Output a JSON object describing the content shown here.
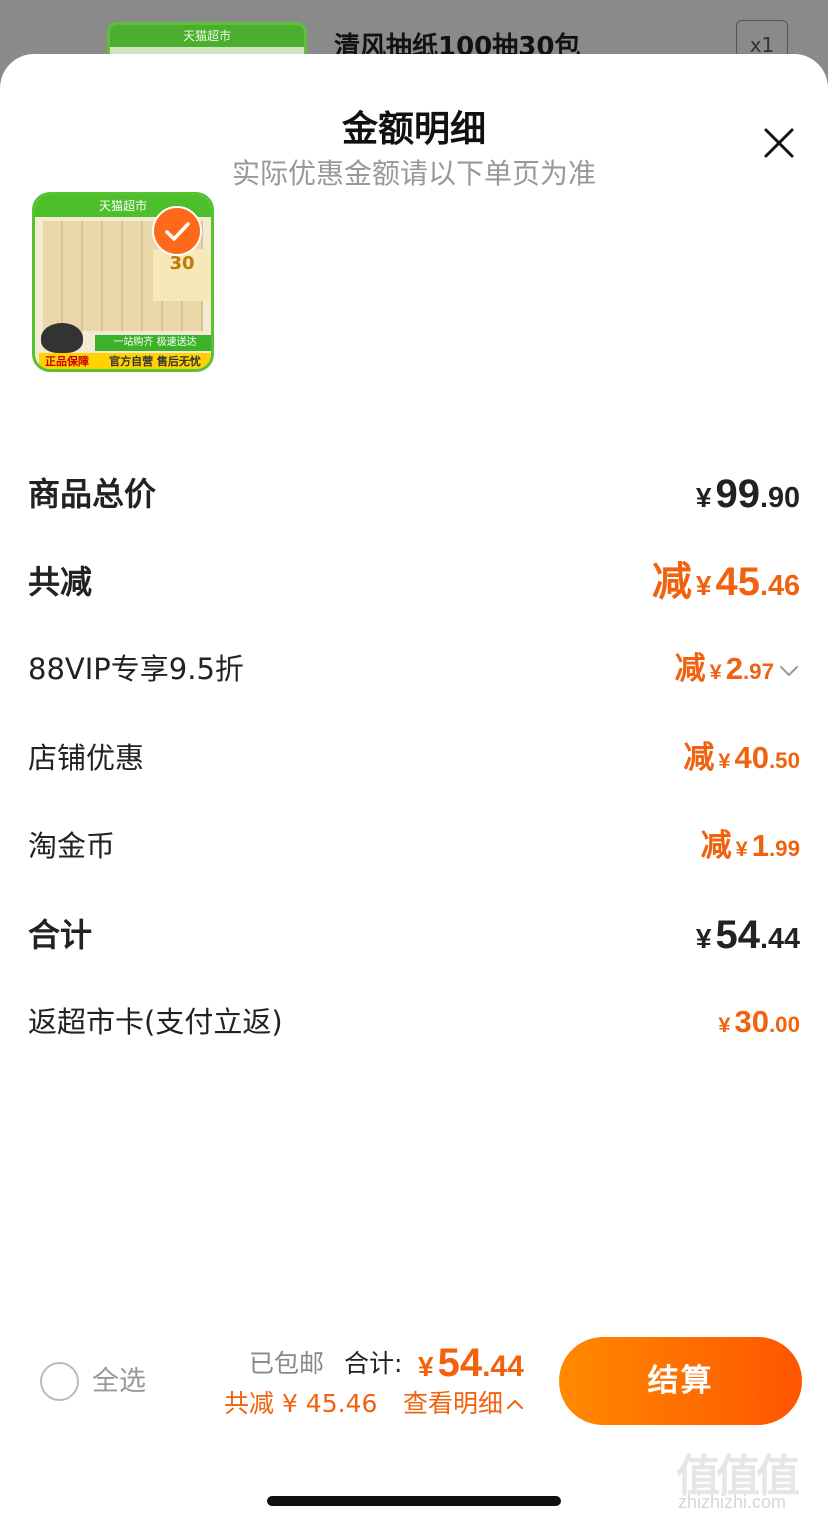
{
  "background": {
    "thumb_label": "天猫超市",
    "title": "清风抽纸100抽30包",
    "qty": "x1"
  },
  "sheet": {
    "title": "金额明细",
    "subtitle": "实际优惠金额请以下单页为准"
  },
  "product": {
    "thumb_top": "天猫超市",
    "thumb_badge": "30",
    "thumb_line1": "一站购齐 极速送达",
    "thumb_line2": "官方自营 售后无忧",
    "thumb_genuine": "正品保障",
    "selected": true
  },
  "lines": {
    "subtotal": {
      "label": "商品总价",
      "yen": "¥",
      "int": "99",
      "cents": ".90"
    },
    "total_discount": {
      "label": "共减",
      "prefix": "减",
      "yen": "¥",
      "int": "45",
      "cents": ".46"
    },
    "vip": {
      "label": "88VIP专享9.5折",
      "prefix": "减",
      "yen": "¥",
      "int": "2",
      "cents": ".97"
    },
    "store": {
      "label": "店铺优惠",
      "prefix": "减",
      "yen": "¥",
      "int": "40",
      "cents": ".50"
    },
    "coins": {
      "label": "淘金币",
      "prefix": "减",
      "yen": "¥",
      "int": "1",
      "cents": ".99"
    },
    "total": {
      "label": "合计",
      "yen": "¥",
      "int": "54",
      "cents": ".44"
    },
    "rebate": {
      "label": "返超市卡(支付立返)",
      "yen": "¥",
      "int": "30",
      "cents": ".00"
    }
  },
  "footer": {
    "select_all": "全选",
    "shipping": "已包邮",
    "total_label": "合计:",
    "total_yen": "¥",
    "total_int": "54",
    "total_cents": ".44",
    "discount_text": "共减 ¥ 45.46",
    "view_detail": "查看明细",
    "checkout": "结算"
  },
  "watermark": {
    "glyphs": "值值值",
    "domain": "zhizhizhi.com"
  },
  "colors": {
    "accent": "#f0620e",
    "checkout_start": "#ff8a00",
    "checkout_end": "#ff5500"
  }
}
